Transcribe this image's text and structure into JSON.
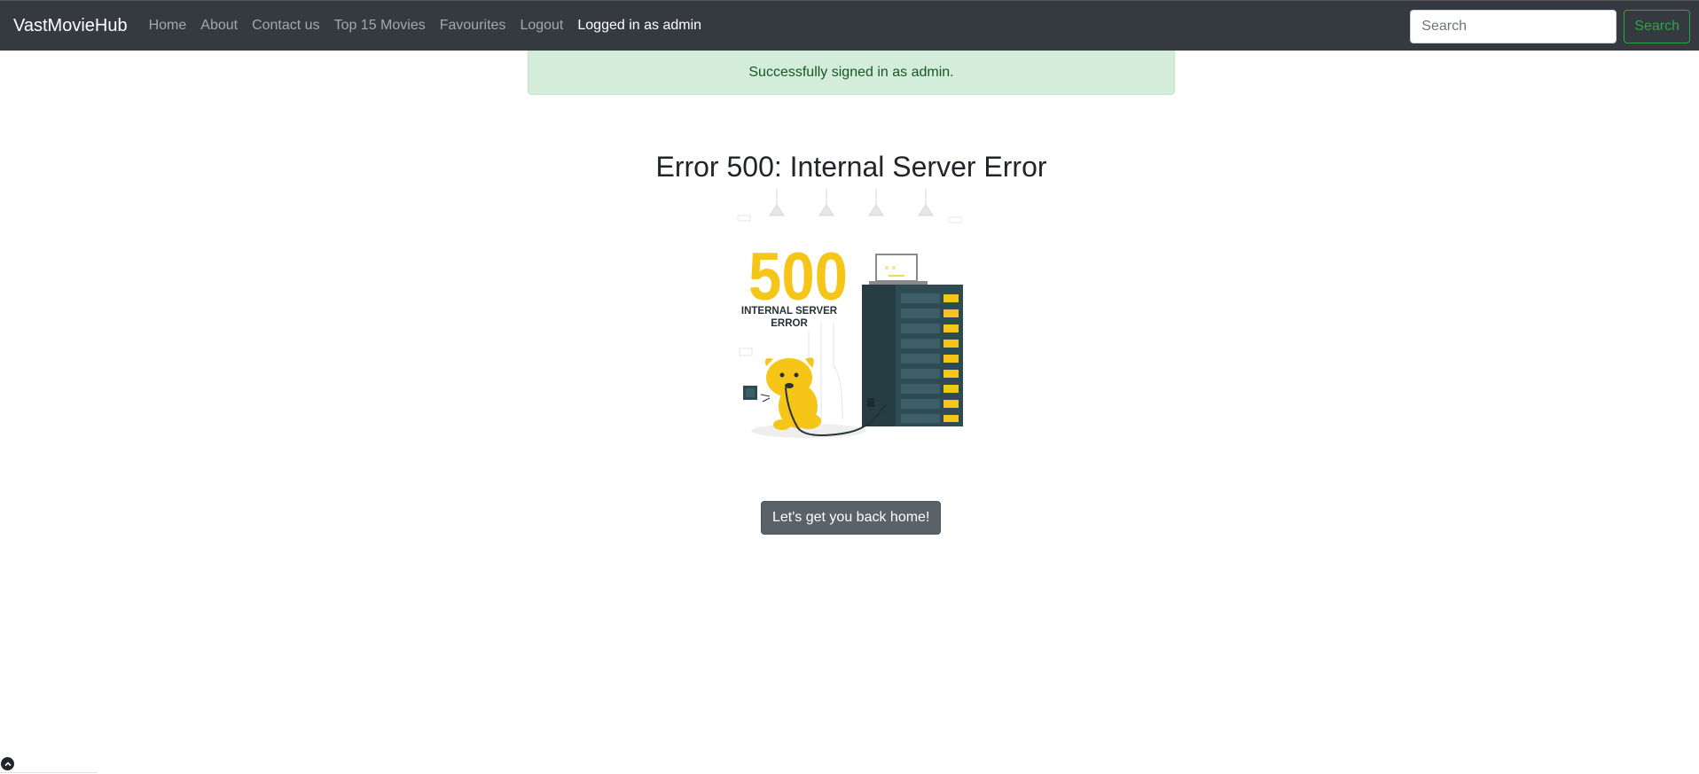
{
  "navbar": {
    "brand": "VastMovieHub",
    "links": [
      {
        "label": "Home"
      },
      {
        "label": "About"
      },
      {
        "label": "Contact us"
      },
      {
        "label": "Top 15 Movies"
      },
      {
        "label": "Favourites"
      },
      {
        "label": "Logout"
      }
    ],
    "status": "Logged in as admin",
    "search": {
      "placeholder": "Search",
      "value": "",
      "button_label": "Search"
    }
  },
  "alert": {
    "message": "Successfully signed in as admin."
  },
  "main": {
    "title": "Error 500: Internal Server Error",
    "illustration": {
      "code": "500",
      "line1": "INTERNAL SERVER",
      "line2": "ERROR",
      "icon": "dog-chewing-server-cable-illustration"
    },
    "home_button": "Let's get you back home!"
  },
  "colors": {
    "navbar_bg": "#343a40",
    "alert_bg": "#d4edda",
    "alert_text": "#155724",
    "search_button": "#28a745",
    "home_button_bg": "#5a6268",
    "illustration_yellow": "#f5c518",
    "server_dark": "#2e4a53"
  }
}
